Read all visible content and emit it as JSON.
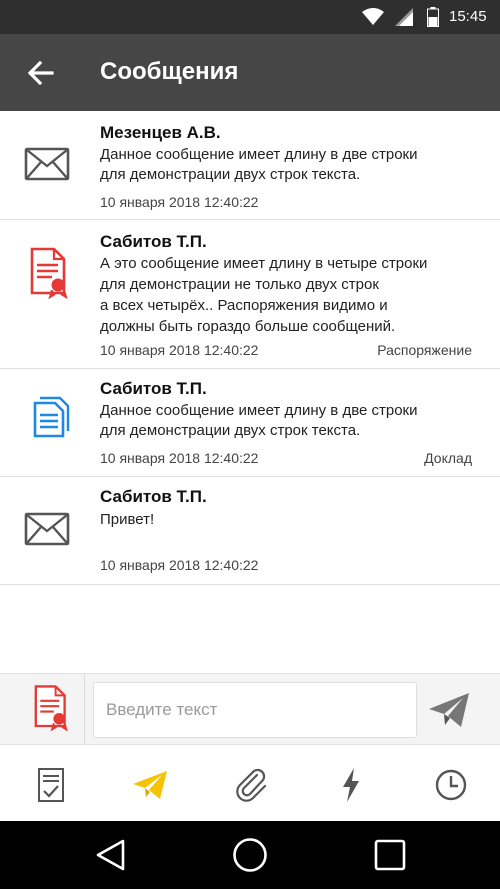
{
  "status_bar": {
    "time": "15:45",
    "icons": [
      "wifi-icon",
      "signal-icon",
      "battery-icon"
    ]
  },
  "app_bar": {
    "title": "Сообщения",
    "back_icon": "arrow-left-icon"
  },
  "messages": [
    {
      "sender": "Мезенцев А.В.",
      "body": "Данное сообщение имеет длину в две строки\nдля демонстрации двух строк текста.",
      "date": "10 января 2018  12:40:22",
      "type": "",
      "icon": "envelope-icon"
    },
    {
      "sender": "Сабитов Т.П.",
      "body": "А это сообщение имеет длину в четыре строки\nдля демонстрации не только двух строк\nа всех четырёх.. Распоряжения видимо и\nдолжны быть гораздо больше сообщений.",
      "date": "10 января 2018  12:40:22",
      "type": "Распоряжение",
      "icon": "order-document-icon"
    },
    {
      "sender": "Сабитов Т.П.",
      "body": "Данное сообщение имеет длину в две строки\nдля демонстрации двух строк текста.",
      "date": "10 января 2018  12:40:22",
      "type": "Доклад",
      "icon": "report-documents-icon"
    },
    {
      "sender": "Сабитов Т.П.",
      "body": "Привет!",
      "date": "10 января 2018  12:40:22",
      "type": "",
      "icon": "envelope-icon"
    }
  ],
  "composer": {
    "placeholder": "Введите текст",
    "value": "",
    "attach_icon": "order-document-icon",
    "send_icon": "send-icon"
  },
  "bottom_nav": {
    "items": [
      {
        "name": "tasks",
        "icon": "checklist-icon",
        "active": false
      },
      {
        "name": "messages",
        "icon": "paper-plane-icon",
        "active": true
      },
      {
        "name": "attachments",
        "icon": "paperclip-icon",
        "active": false
      },
      {
        "name": "events",
        "icon": "lightning-icon",
        "active": false
      },
      {
        "name": "history",
        "icon": "clock-icon",
        "active": false
      }
    ],
    "active_color": "#f5c400",
    "inactive_color": "#555555"
  },
  "colors": {
    "app_bar": "#464646",
    "status_bar": "#2f2f2f",
    "doc_red": "#e53935",
    "doc_blue": "#1e88e5"
  }
}
